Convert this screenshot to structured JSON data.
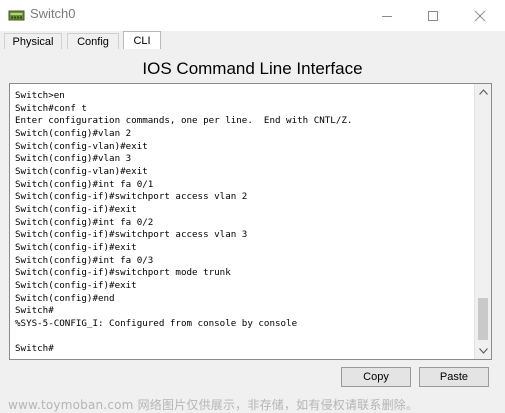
{
  "window": {
    "title": "Switch0",
    "icon": "switch-device-icon"
  },
  "tabs": [
    {
      "label": "Physical",
      "active": false
    },
    {
      "label": "Config",
      "active": false
    },
    {
      "label": "CLI",
      "active": true
    }
  ],
  "main": {
    "heading": "IOS Command Line Interface"
  },
  "console": {
    "lines": [
      "Switch>en",
      "Switch#conf t",
      "Enter configuration commands, one per line.  End with CNTL/Z.",
      "Switch(config)#vlan 2",
      "Switch(config-vlan)#exit",
      "Switch(config)#vlan 3",
      "Switch(config-vlan)#exit",
      "Switch(config)#int fa 0/1",
      "Switch(config-if)#switchport access vlan 2",
      "Switch(config-if)#exit",
      "Switch(config)#int fa 0/2",
      "Switch(config-if)#switchport access vlan 3",
      "Switch(config-if)#exit",
      "Switch(config)#int fa 0/3",
      "Switch(config-if)#switchport mode trunk",
      "Switch(config-if)#exit",
      "Switch(config)#end",
      "Switch#",
      "%SYS-5-CONFIG_I: Configured from console by console",
      "",
      "Switch#"
    ]
  },
  "buttons": {
    "copy": "Copy",
    "paste": "Paste"
  },
  "watermark": "www.toymoban.com 网络图片仅供展示，非存储，如有侵权请联系删除。"
}
